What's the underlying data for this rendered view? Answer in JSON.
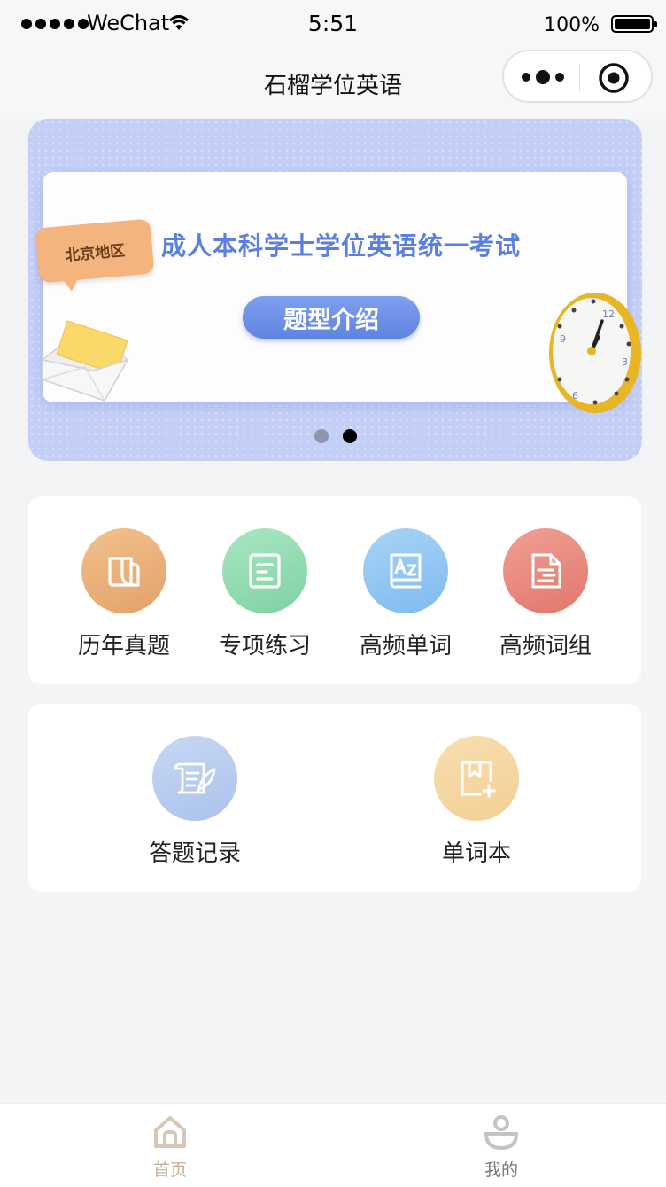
{
  "status_bar": {
    "carrier": "WeChat",
    "time": "5:51",
    "battery": "100%"
  },
  "nav": {
    "title": "石榴学位英语"
  },
  "banner": {
    "region": "北京地区",
    "title": "成人本科学士学位英语统一考试",
    "button": "题型介绍",
    "page_count": 2,
    "active_index": 1
  },
  "features": [
    {
      "label": "历年真题",
      "icon": "folder-icon",
      "color": "#e8a872"
    },
    {
      "label": "专项练习",
      "icon": "list-icon",
      "color": "#8ad8ab"
    },
    {
      "label": "高频单词",
      "icon": "az-book-icon",
      "color": "#8cc4f2"
    },
    {
      "label": "高频词组",
      "icon": "document-icon",
      "color": "#e8847a"
    }
  ],
  "tools": [
    {
      "label": "答题记录",
      "icon": "scroll-quill-icon",
      "color": "#b4c9ef"
    },
    {
      "label": "单词本",
      "icon": "bookmark-add-icon",
      "color": "#f5d7a3"
    }
  ],
  "tabbar": {
    "home": "首页",
    "me": "我的",
    "active": "home",
    "active_color": "#c9ad95"
  }
}
